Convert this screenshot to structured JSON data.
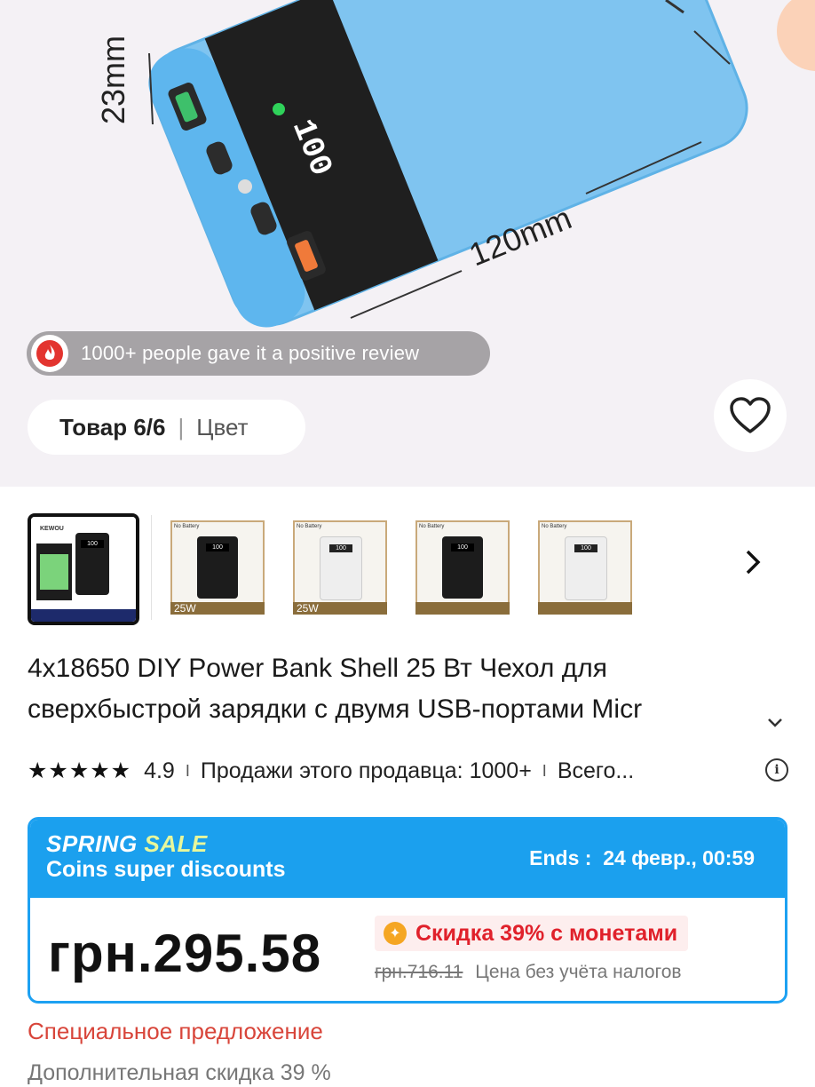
{
  "hero": {
    "review_text": "1000+ people gave it a positive review",
    "counter": "Товар 6/6",
    "counter_sep": "|",
    "color_label": "Цвет",
    "dimension_height": "23mm",
    "dimension_length": "120mm",
    "device_display": "100",
    "device_color": "#76c1ee"
  },
  "thumbnails": {
    "items": [
      {
        "label": "",
        "screen": "100",
        "variant": "black",
        "selected": true
      },
      {
        "label": "No Battery",
        "screen": "100",
        "variant": "black",
        "badge": "25W"
      },
      {
        "label": "No Battery",
        "screen": "100",
        "variant": "white",
        "badge": "25W"
      },
      {
        "label": "No Battery",
        "screen": "100",
        "variant": "black"
      },
      {
        "label": "No Battery",
        "screen": "100",
        "variant": "white"
      }
    ],
    "selected_brand": "KEWOU"
  },
  "title": {
    "line1": "4x18650 DIY Power Bank Shell 25 Вт Чехол для",
    "line2": "сверхбыстрой зарядки с двумя USB-портами Micr"
  },
  "rating": {
    "stars": "★★★★★",
    "score": "4.9",
    "sep": "I",
    "sales": "Продажи этого продавца: 1000+",
    "sep2": "I",
    "total": "Всего..."
  },
  "price_card": {
    "sale_word1": "SPRING",
    "sale_word2": "SALE",
    "coins_text": "Coins super discounts",
    "ends_label": "Ends :",
    "ends_value": "24 февр., 00:59",
    "price": "грн.295.58",
    "discount_text": "Скидка 39% с монетами",
    "old_price": "грн.716.11",
    "tax_note": "Цена без учёта налогов",
    "accent_color": "#1ba0ee",
    "discount_color": "#e0212b"
  },
  "offer": {
    "special": "Специальное предложение",
    "extra": "Дополнительная скидка 39 %"
  }
}
